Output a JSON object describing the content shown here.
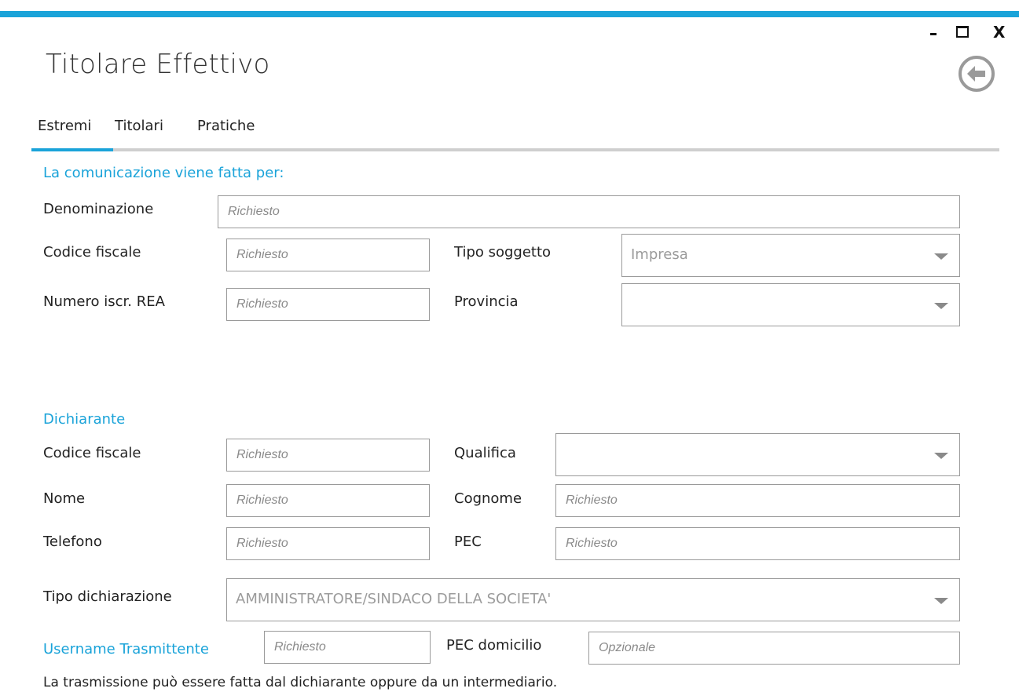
{
  "window": {
    "title": "Titolare Effettivo",
    "minimize_glyph": "",
    "close_glyph": "X"
  },
  "tabs": [
    {
      "label": "Estremi",
      "active": true
    },
    {
      "label": "Titolari",
      "active": false
    },
    {
      "label": "Pratiche",
      "active": false
    }
  ],
  "comunicazione": {
    "section_label": "La comunicazione viene fatta per:",
    "denominazione": {
      "label": "Denominazione",
      "placeholder": "Richiesto",
      "value": ""
    },
    "codice_fiscale": {
      "label": "Codice fiscale",
      "placeholder": "Richiesto",
      "value": ""
    },
    "tipo_soggetto": {
      "label": "Tipo soggetto",
      "value": "Impresa"
    },
    "numero_rea": {
      "label": "Numero iscr. REA",
      "placeholder": "Richiesto",
      "value": ""
    },
    "provincia": {
      "label": "Provincia",
      "value": ""
    }
  },
  "dichiarante": {
    "section_label": "Dichiarante",
    "codice_fiscale": {
      "label": "Codice fiscale",
      "placeholder": "Richiesto",
      "value": ""
    },
    "qualifica": {
      "label": "Qualifica",
      "value": ""
    },
    "nome": {
      "label": "Nome",
      "placeholder": "Richiesto",
      "value": ""
    },
    "cognome": {
      "label": "Cognome",
      "placeholder": "Richiesto",
      "value": ""
    },
    "telefono": {
      "label": "Telefono",
      "placeholder": "Richiesto",
      "value": ""
    },
    "pec": {
      "label": "PEC",
      "placeholder": "Richiesto",
      "value": ""
    },
    "tipo_dichiarazione": {
      "label": "Tipo dichiarazione",
      "value": "AMMINISTRATORE/SINDACO DELLA SOCIETA'"
    }
  },
  "trasmissione": {
    "username_label": "Username Trasmittente",
    "username_placeholder": "Richiesto",
    "pec_domicilio_label": "PEC domicilio",
    "pec_domicilio_placeholder": "Opzionale",
    "note": "La trasmissione può essere fatta dal dichiarante oppure da un intermediario."
  },
  "colors": {
    "accent": "#1aa3d9",
    "border": "#9a9a9a",
    "placeholder": "#8a8a8a"
  },
  "icons": {
    "back": "back-arrow-circle-icon",
    "minimize": "minimize-icon",
    "maximize": "maximize-icon",
    "close": "close-icon",
    "dropdown": "chevron-down-icon"
  }
}
